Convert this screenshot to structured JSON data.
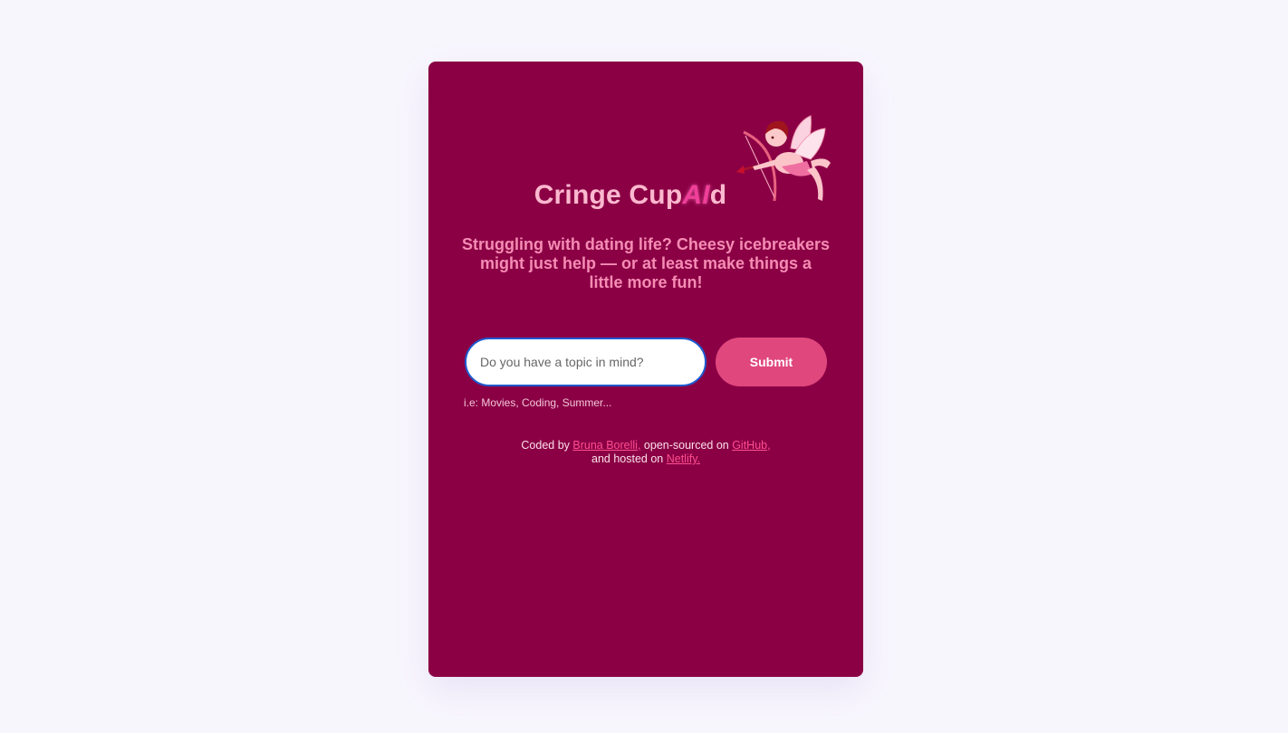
{
  "app": {
    "title_prefix": "Cringe Cup",
    "title_ai": "AI",
    "title_suffix": "d",
    "tagline": "Struggling with dating life? Cheesy icebreakers might just help — or at least make things a little more fun!"
  },
  "form": {
    "topic_placeholder": "Do you have a topic in mind?",
    "topic_value": "",
    "submit_label": "Submit",
    "hint": "i.e: Movies, Coding, Summer..."
  },
  "credits": {
    "line1_prefix": "Coded by ",
    "author_link": "Bruna Borelli,",
    "line1_middle": " open-sourced on ",
    "github_link": "GitHub,",
    "line2_prefix": "and hosted on ",
    "netlify_link": "Netlify."
  },
  "icons": {
    "mascot": "cupid-icon"
  },
  "colors": {
    "page_background": "#f8f6fd",
    "card_background": "#8b0045",
    "title": "#fbb8cf",
    "title_accent": "#ef3f99",
    "tagline": "#f58cb4",
    "button": "#e0477d",
    "link": "#ff4f8f"
  }
}
